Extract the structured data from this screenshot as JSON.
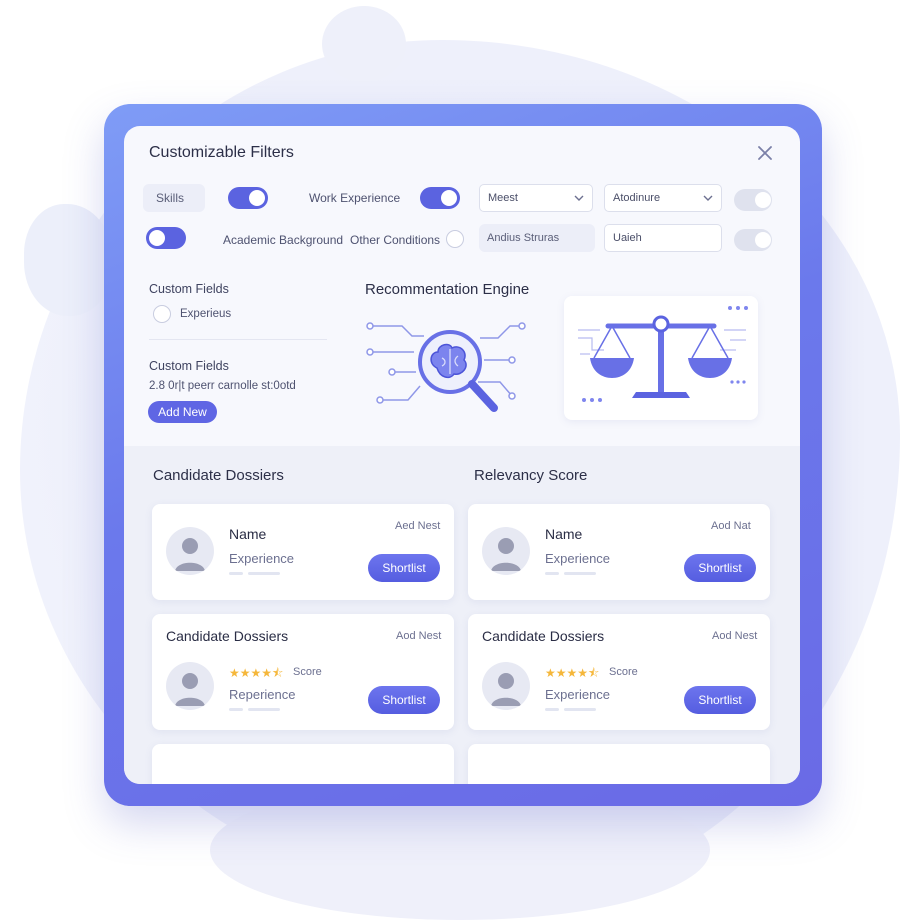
{
  "filters": {
    "title": "Customizable Filters",
    "skills_label": "Skills",
    "work_experience_label": "Work Experience",
    "select_1": "Meest",
    "select_2": "Atodinure",
    "academic_label": "Academic Background",
    "other_conditions_label": "Other Conditions",
    "field_1": "Andius Struras",
    "field_2": "Uaieh",
    "toggles": {
      "skills": true,
      "work_experience": true,
      "row1_right": false,
      "academic": true,
      "row2_right": false
    }
  },
  "custom_fields": {
    "title_1": "Custom Fields",
    "option_1": "Experieus",
    "title_2": "Custom Fields",
    "note": "2.8 0r|t peerr carnolle st:0otd",
    "add_button": "Add New"
  },
  "engine": {
    "title": "Recommentation Engine"
  },
  "dossiers": {
    "title_left": "Candidate Dossiers",
    "title_right": "Relevancy Score",
    "cards": [
      {
        "heading": "Name",
        "sub": "Experience",
        "tag": "Aed Nest",
        "button": "Shortlist"
      },
      {
        "heading": "Name",
        "sub": "Experience",
        "tag": "Aod Nat",
        "button": "Shortlist"
      },
      {
        "heading": "Candidate Dossiers",
        "sub": "Reperience",
        "tag": "Aod Nest",
        "score": "Score",
        "rating": 4.5,
        "button": "Shortlist"
      },
      {
        "heading": "Candidate Dossiers",
        "sub": "Experience",
        "tag": "Aod Nest",
        "score": "Score",
        "rating": 4.5,
        "button": "Shortlist"
      }
    ]
  },
  "colors": {
    "accent": "#5b63e0",
    "frame": "#6b79ec",
    "star": "#f5b73b"
  },
  "icons": [
    "close-icon",
    "chevron-down-icon",
    "brain-magnifier-icon",
    "balance-scale-icon",
    "user-avatar-icon",
    "star-icon"
  ]
}
